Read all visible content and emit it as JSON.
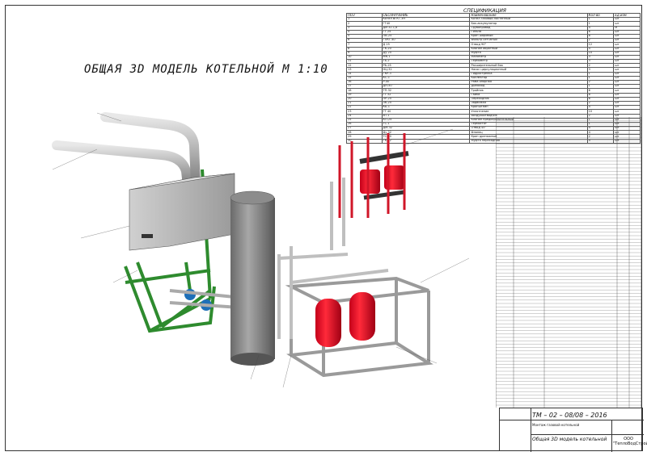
{
  "drawing": {
    "title": "ОБЩАЯ 3D МОДЕЛЬ КОТЕЛЬНОЙ М 1:10"
  },
  "specification": {
    "title": "СПЕЦИФИКАЦИЯ",
    "headers": [
      "ПОЗ",
      "ОБОЗНАЧЕНИЕ",
      "Наименование",
      "Кол-во",
      "Ед.изм"
    ],
    "rows": [
      [
        "1",
        "Котёл ВГКГ-3Н",
        "Котёл газовый настенный",
        "1",
        "шт"
      ],
      [
        "2",
        "ГТ40",
        "Бак-аккумулятор",
        "1",
        "шт"
      ],
      [
        "3",
        "Дм 32-1,6",
        "Трубопровод",
        "4",
        "м"
      ],
      [
        "4",
        "ГТ 25",
        "Гильза",
        "6",
        "шт"
      ],
      [
        "5",
        "ПВ-25",
        "Кран шаровый",
        "8",
        "шт"
      ],
      [
        "6",
        "ГПКТ-40",
        "Фильтр сетчатый",
        "2",
        "шт"
      ],
      [
        "7",
        "Д 25",
        "Отвод 90°",
        "12",
        "шт"
      ],
      [
        "8",
        "ГК-20",
        "Клапан обратный",
        "4",
        "шт"
      ],
      [
        "9",
        "Ду 25",
        "Муфта",
        "10",
        "шт"
      ],
      [
        "10",
        "МК-1",
        "Манометр",
        "3",
        "шт"
      ],
      [
        "11",
        "ТБ-2",
        "Термометр",
        "3",
        "шт"
      ],
      [
        "12",
        "РБ-25",
        "Расширительный бак",
        "2",
        "шт"
      ],
      [
        "13",
        "НЦ-32",
        "Насос циркуляционный",
        "3",
        "шт"
      ],
      [
        "14",
        "ГКР-3",
        "Гидрострелка",
        "1",
        "шт"
      ],
      [
        "15",
        "КС-1",
        "Коллектор",
        "1",
        "шт"
      ],
      [
        "16",
        "Р-40",
        "Рама опорная",
        "2",
        "шт"
      ],
      [
        "17",
        "ДН-50",
        "Дымоход",
        "1",
        "шт"
      ],
      [
        "18",
        "ТП-32",
        "Тройник",
        "6",
        "шт"
      ],
      [
        "19",
        "ГТ 32",
        "Гайка",
        "8",
        "шт"
      ],
      [
        "20",
        "ПР-25",
        "Переходник",
        "6",
        "шт"
      ],
      [
        "21",
        "ЗК-25",
        "Задвижка",
        "2",
        "шт"
      ],
      [
        "22",
        "КБ-1",
        "Кронштейн",
        "4",
        "шт"
      ],
      [
        "23",
        "ГТ 40",
        "Уплотнение",
        "10",
        "шт"
      ],
      [
        "24",
        "ВТ-1",
        "Воздухоотводчик",
        "2",
        "шт"
      ],
      [
        "25",
        "КП-25",
        "Клапан предохранительный",
        "1",
        "шт"
      ],
      [
        "26",
        "ТС-1",
        "Термостат",
        "1",
        "шт"
      ],
      [
        "27",
        "ДМ-32",
        "Отвод 45°",
        "4",
        "шт"
      ],
      [
        "28",
        "Ду 32",
        "Фланец",
        "4",
        "шт"
      ],
      [
        "29",
        "ТС-40",
        "Кран дренажный",
        "2",
        "шт"
      ],
      [
        "30",
        "ГК-32",
        "Муфта переходная",
        "4",
        "шт"
      ]
    ]
  },
  "stamp": {
    "code": "ТМ – 02 – 08/08 – 2016",
    "description": "Монтаж газовой котельной",
    "name": "Общая 3D модель котельной",
    "org": "ООО \"ТеплоВодСтройМонтаж\""
  }
}
